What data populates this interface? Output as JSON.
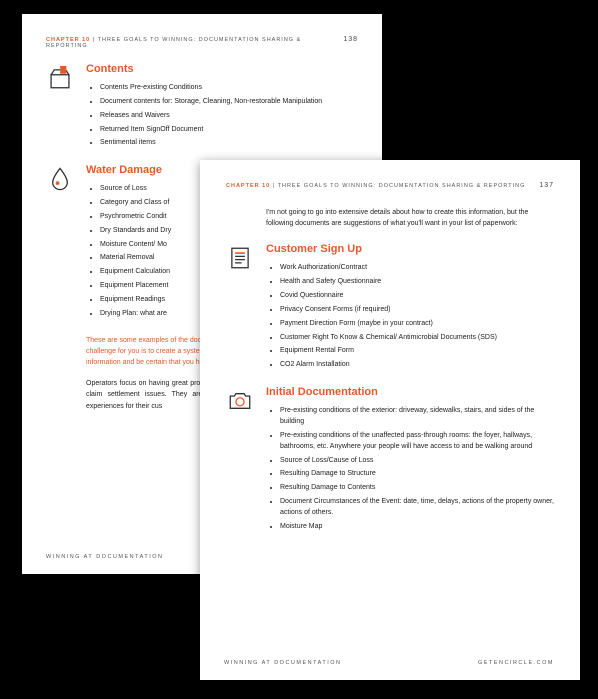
{
  "back": {
    "chapter_prefix": "CHAPTER 10",
    "chapter_title": " | Three goals to winning: Documentation sharing & reporting",
    "page_number": "138",
    "sections": {
      "contents": {
        "title": "Contents",
        "items": [
          "Contents Pre-existing Conditions",
          "Document contents for: Storage, Cleaning, Non-restorable Manipulation",
          "Releases and Waivers",
          "Returned Item SignOff Document",
          "Sentimental items"
        ]
      },
      "water": {
        "title": "Water Damage",
        "items": [
          "Source of Loss",
          "Category and Class of",
          "Psychrometric Condit",
          "Dry Standards and Dry",
          "Moisture Content/ Mo",
          "Material Removal",
          "Equipment Calculation",
          "Equipment Placement",
          "Equipment Readings",
          "Drying Plan: what are"
        ]
      }
    },
    "orange_para": "These are some examples of the documentation you need to do your job. The challenge for you is to create a system where you can accurately document this information and be certain that you have the informa",
    "body_para": "Operators focus on having great processes to increase profits, and reduce their risk of claim settlement issues. They are focused on providing consistent, high-quality experiences for their cus",
    "footer_left": "WINNING AT DOCUMENTATION"
  },
  "front": {
    "chapter_prefix": "CHAPTER 10",
    "chapter_title": " | Three goals to winning: Documentation sharing & reporting",
    "page_number": "137",
    "intro": "I'm not going to go into extensive details about how to create this information, but the following documents are suggestions of what you'll want in your list of paperwork:",
    "sections": {
      "signup": {
        "title": "Customer Sign Up",
        "items": [
          "Work Authorization/Contract",
          "Health and Safety Questionnaire",
          "Covid Questionnaire",
          "Privacy Consent Forms (if required)",
          "Payment Direction Form (maybe in your contract)",
          "Customer Right To Know & Chemical/ Antimicrobial Documents (SDS)",
          "Equipment Rental Form",
          "CO2 Alarm Installation"
        ]
      },
      "initial": {
        "title": "Initial Documentation",
        "items": [
          "Pre-existing conditions of the exterior: driveway, sidewalks, stairs, and sides of the building",
          "Pre-existing conditions of the unaffected pass-through rooms: the foyer, hallways, bathrooms, etc. Anywhere your people will have access to and be walking around",
          "Source of Loss/Cause of Loss",
          "Resulting Damage to Structure",
          "Resulting Damage to Contents",
          "Document Circumstances of the Event: date, time, delays, actions of the property owner, actions of others.",
          "Moisture Map"
        ]
      }
    },
    "footer_left": "WINNING AT DOCUMENTATION",
    "footer_right": "GETENCIRCLE.COM"
  }
}
